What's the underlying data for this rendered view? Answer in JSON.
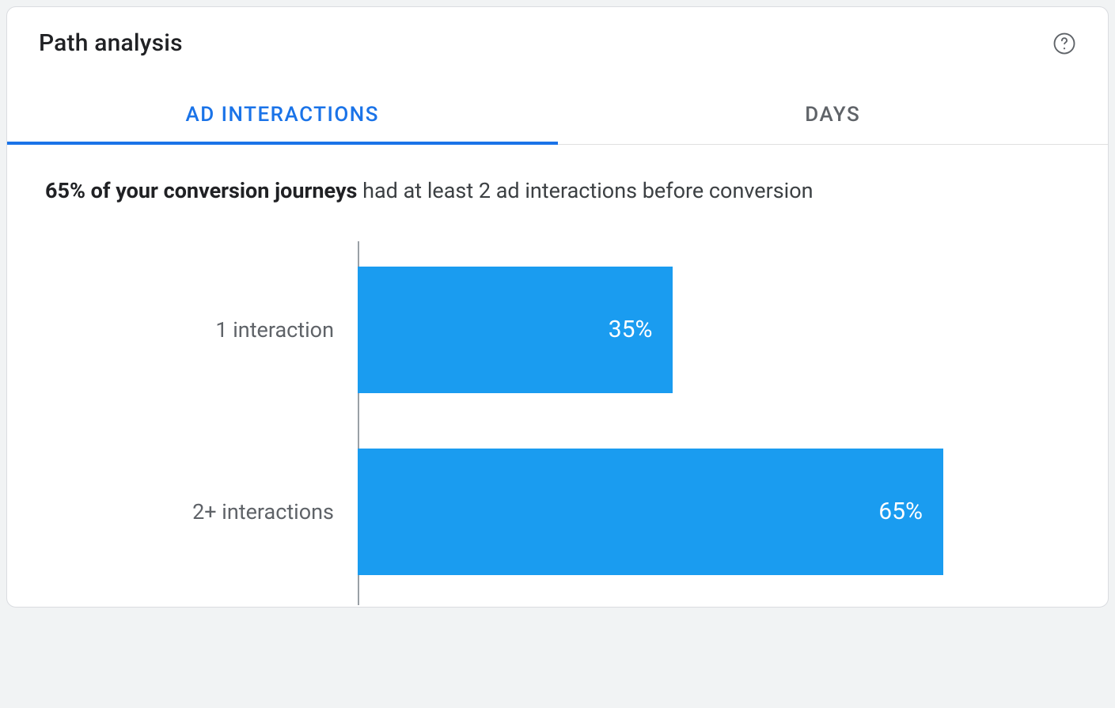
{
  "card": {
    "title": "Path analysis"
  },
  "tabs": {
    "ad_interactions": "AD INTERACTIONS",
    "days": "DAYS",
    "active": "ad_interactions"
  },
  "insight": {
    "bold": "65% of your conversion journeys",
    "rest": " had at least 2 ad interactions before conversion"
  },
  "colors": {
    "accent": "#1a73e8",
    "bar": "#1a9cf0",
    "text_muted": "#5f6368"
  },
  "chart_data": {
    "type": "bar",
    "orientation": "horizontal",
    "categories": [
      "1 interaction",
      "2+ interactions"
    ],
    "values": [
      35,
      65
    ],
    "value_labels": [
      "35%",
      "65%"
    ],
    "xlim": [
      0,
      100
    ],
    "ylabel": "",
    "xlabel": ""
  }
}
